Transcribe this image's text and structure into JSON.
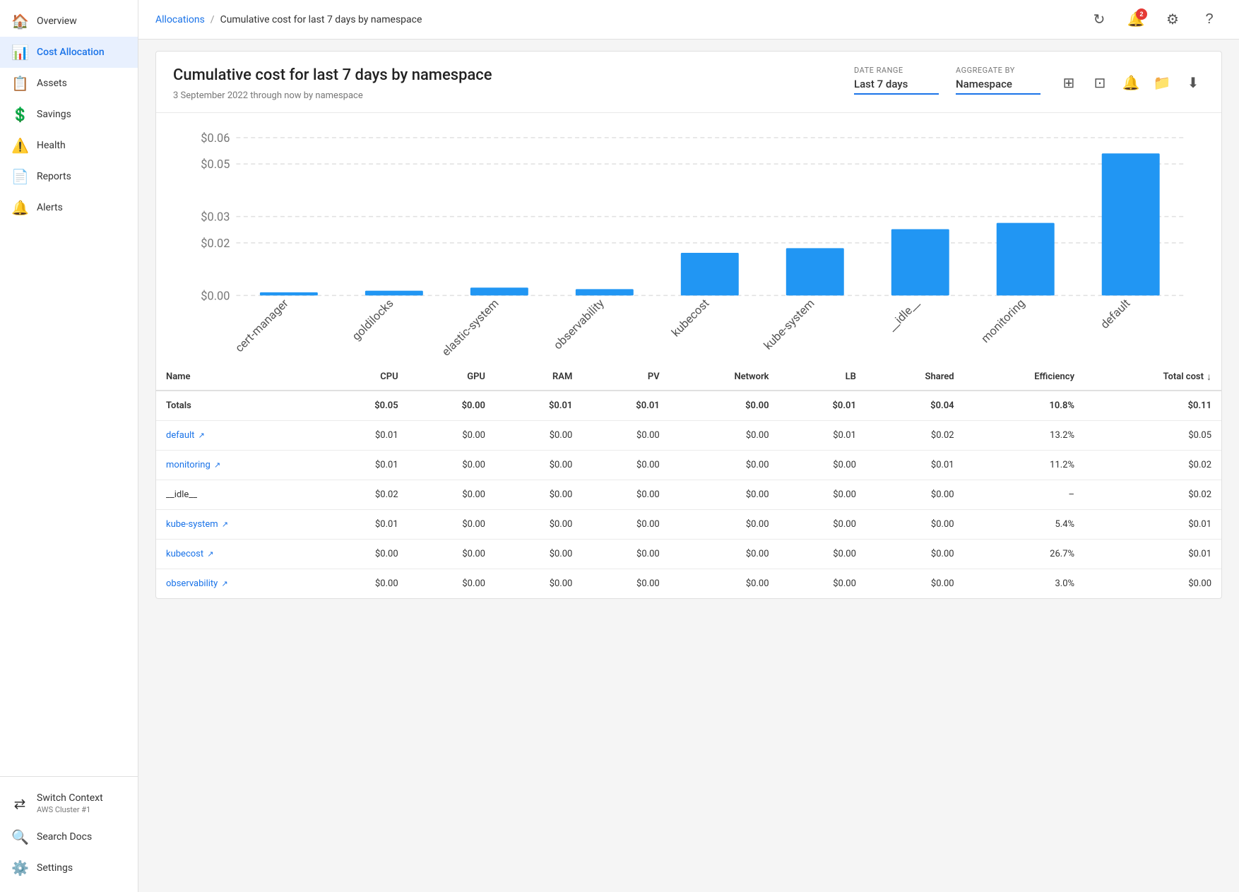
{
  "sidebar": {
    "items": [
      {
        "id": "overview",
        "label": "Overview",
        "icon": "🏠",
        "active": false
      },
      {
        "id": "cost-allocation",
        "label": "Cost Allocation",
        "icon": "📊",
        "active": true
      },
      {
        "id": "assets",
        "label": "Assets",
        "icon": "📋",
        "active": false
      },
      {
        "id": "savings",
        "label": "Savings",
        "icon": "💲",
        "active": false
      },
      {
        "id": "health",
        "label": "Health",
        "icon": "⚠️",
        "active": false
      },
      {
        "id": "reports",
        "label": "Reports",
        "icon": "📄",
        "active": false
      },
      {
        "id": "alerts",
        "label": "Alerts",
        "icon": "🔔",
        "active": false
      }
    ],
    "bottom": [
      {
        "id": "switch-context",
        "label": "Switch Context",
        "sublabel": "AWS Cluster #1",
        "icon": "⇄"
      },
      {
        "id": "search-docs",
        "label": "Search Docs",
        "icon": "🔍"
      },
      {
        "id": "settings",
        "label": "Settings",
        "icon": "⚙️"
      }
    ]
  },
  "topbar": {
    "breadcrumb_link": "Allocations",
    "breadcrumb_sep": "/",
    "breadcrumb_current": "Cumulative cost for last 7 days by namespace",
    "notif_count": "2",
    "actions": [
      "refresh",
      "notifications",
      "settings",
      "help"
    ]
  },
  "report": {
    "title": "Cumulative cost for last 7 days by namespace",
    "subtitle": "3 September 2022 through now by namespace",
    "date_range_label": "Date Range",
    "date_range_value": "Last 7 days",
    "aggregate_label": "Aggregate by",
    "aggregate_value": "Namespace",
    "action_icons": [
      "filter",
      "bookmark",
      "alert",
      "folder",
      "download"
    ]
  },
  "chart": {
    "y_labels": [
      "$0.06",
      "$0.05",
      "$0.03",
      "$0.02",
      "$0.00"
    ],
    "bars": [
      {
        "label": "cert-manager",
        "height_pct": 2
      },
      {
        "label": "goldilocks",
        "height_pct": 3
      },
      {
        "label": "elastic-system",
        "height_pct": 5
      },
      {
        "label": "observability",
        "height_pct": 4
      },
      {
        "label": "kubecost",
        "height_pct": 27
      },
      {
        "label": "kube-system",
        "height_pct": 30
      },
      {
        "label": "__idle__",
        "height_pct": 42
      },
      {
        "label": "monitoring",
        "height_pct": 46
      },
      {
        "label": "default",
        "height_pct": 90
      }
    ],
    "bar_color": "#2196f3"
  },
  "table": {
    "columns": [
      "Name",
      "CPU",
      "GPU",
      "RAM",
      "PV",
      "Network",
      "LB",
      "Shared",
      "Efficiency",
      "Total cost"
    ],
    "totals": {
      "name": "Totals",
      "cpu": "$0.05",
      "gpu": "$0.00",
      "ram": "$0.01",
      "pv": "$0.01",
      "network": "$0.00",
      "lb": "$0.01",
      "shared": "$0.04",
      "efficiency": "10.8%",
      "total_cost": "$0.11"
    },
    "rows": [
      {
        "name": "default",
        "link": true,
        "cpu": "$0.01",
        "gpu": "$0.00",
        "ram": "$0.00",
        "pv": "$0.00",
        "network": "$0.00",
        "lb": "$0.01",
        "shared": "$0.02",
        "efficiency": "13.2%",
        "total_cost": "$0.05"
      },
      {
        "name": "monitoring",
        "link": true,
        "cpu": "$0.01",
        "gpu": "$0.00",
        "ram": "$0.00",
        "pv": "$0.00",
        "network": "$0.00",
        "lb": "$0.00",
        "shared": "$0.01",
        "efficiency": "11.2%",
        "total_cost": "$0.02"
      },
      {
        "name": "__idle__",
        "link": false,
        "cpu": "$0.02",
        "gpu": "$0.00",
        "ram": "$0.00",
        "pv": "$0.00",
        "network": "$0.00",
        "lb": "$0.00",
        "shared": "$0.00",
        "efficiency": "–",
        "total_cost": "$0.02"
      },
      {
        "name": "kube-system",
        "link": true,
        "cpu": "$0.01",
        "gpu": "$0.00",
        "ram": "$0.00",
        "pv": "$0.00",
        "network": "$0.00",
        "lb": "$0.00",
        "shared": "$0.00",
        "efficiency": "5.4%",
        "total_cost": "$0.01"
      },
      {
        "name": "kubecost",
        "link": true,
        "cpu": "$0.00",
        "gpu": "$0.00",
        "ram": "$0.00",
        "pv": "$0.00",
        "network": "$0.00",
        "lb": "$0.00",
        "shared": "$0.00",
        "efficiency": "26.7%",
        "total_cost": "$0.01"
      },
      {
        "name": "observability",
        "link": true,
        "cpu": "$0.00",
        "gpu": "$0.00",
        "ram": "$0.00",
        "pv": "$0.00",
        "network": "$0.00",
        "lb": "$0.00",
        "shared": "$0.00",
        "efficiency": "3.0%",
        "total_cost": "$0.00"
      }
    ]
  }
}
